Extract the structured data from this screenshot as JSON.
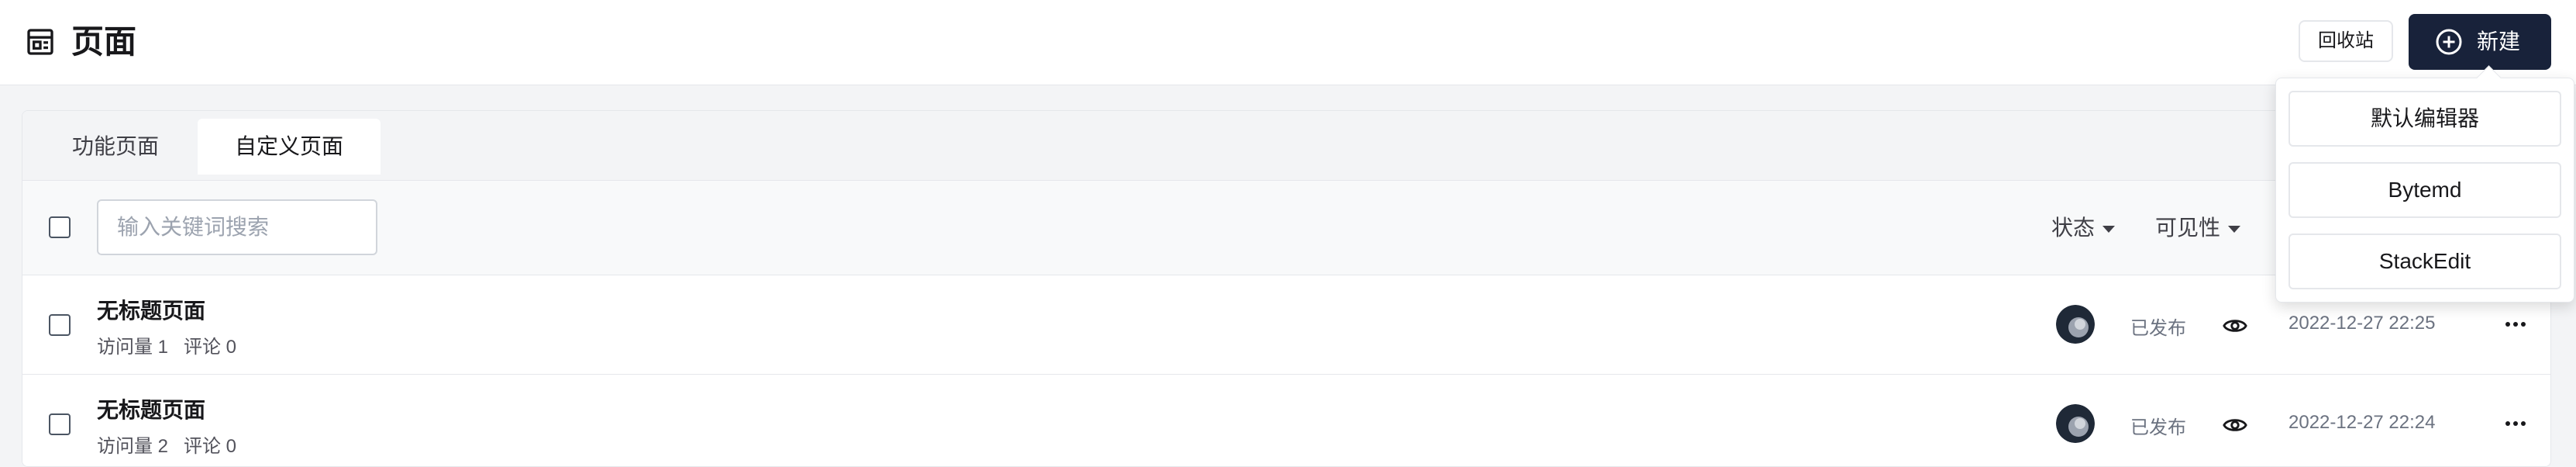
{
  "header": {
    "title": "页面",
    "recycle_label": "回收站",
    "new_label": "新建"
  },
  "tabs": [
    {
      "label": "功能页面"
    },
    {
      "label": "自定义页面"
    }
  ],
  "filter": {
    "search_placeholder": "输入关键词搜索",
    "status_label": "状态",
    "visibility_label": "可见性"
  },
  "rows": [
    {
      "title": "无标题页面",
      "visits": "访问量 1",
      "comments": "评论 0",
      "status": "已发布",
      "date": "2022-12-27 22:25"
    },
    {
      "title": "无标题页面",
      "visits": "访问量 2",
      "comments": "评论 0",
      "status": "已发布",
      "date": "2022-12-27 22:24"
    }
  ],
  "dropdown": {
    "items": [
      {
        "label": "默认编辑器"
      },
      {
        "label": "Bytemd"
      },
      {
        "label": "StackEdit"
      }
    ]
  },
  "icons": {
    "title": "page-icon",
    "new": "plus-circle-icon",
    "row_visibility": "eye-icon",
    "row_actions": "more-horizontal-icon"
  },
  "colors": {
    "primary": "#18223a",
    "background": "#f3f4f6",
    "border": "#e5e7eb"
  }
}
